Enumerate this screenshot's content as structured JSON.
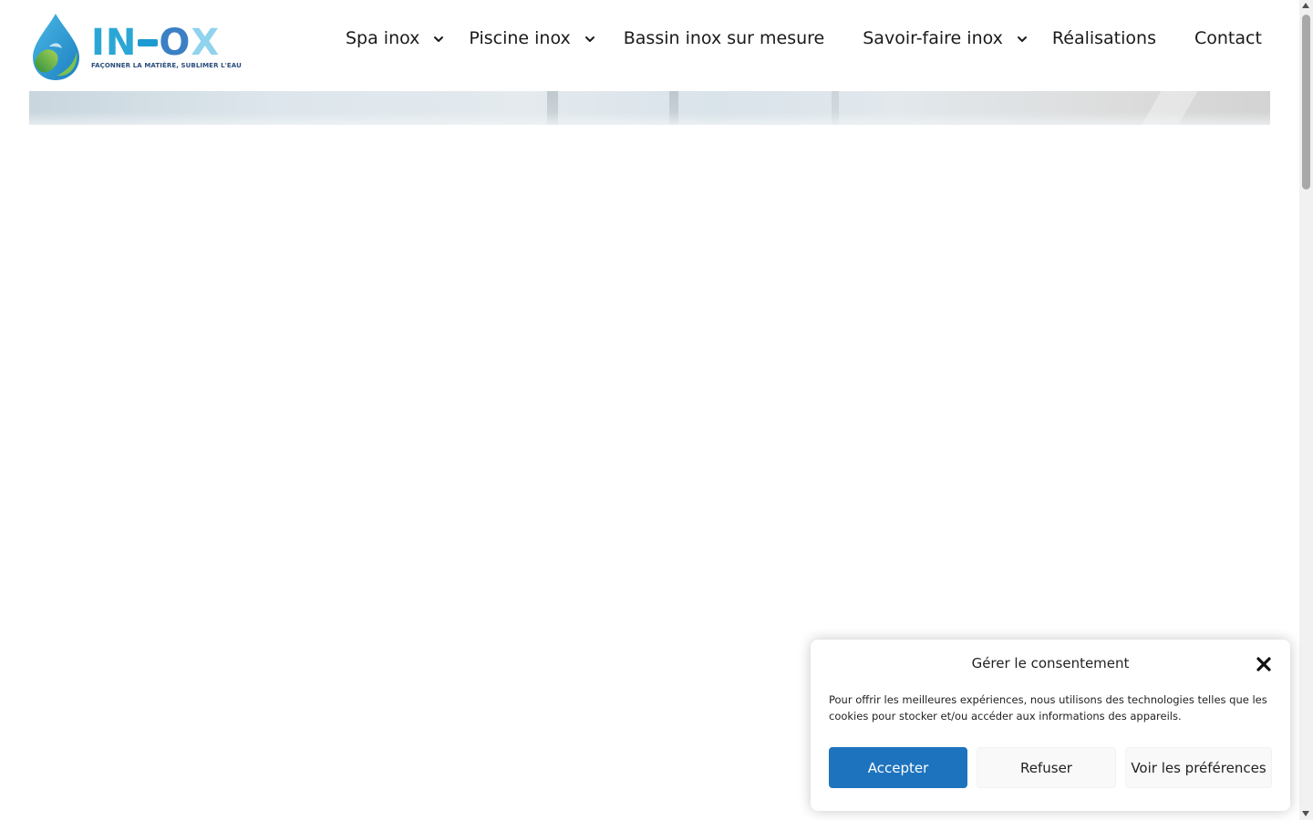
{
  "brand": {
    "logo_word_start": "IN",
    "logo_word_o": "O",
    "logo_word_x": "X",
    "tagline": "FAÇONNER LA MATIÈRE, SUBLIMER L'EAU"
  },
  "nav": {
    "items": [
      {
        "label": "Spa inox",
        "has_dropdown": true
      },
      {
        "label": "Piscine inox",
        "has_dropdown": true
      },
      {
        "label": "Bassin inox sur mesure",
        "has_dropdown": false
      },
      {
        "label": "Savoir-faire inox",
        "has_dropdown": true
      },
      {
        "label": "Réalisations",
        "has_dropdown": false
      },
      {
        "label": "Contact",
        "has_dropdown": false
      }
    ]
  },
  "consent": {
    "title": "Gérer le consentement",
    "body": "Pour offrir les meilleures expériences, nous utilisons des technologies telles que les cookies pour stocker et/ou accéder aux informations des appareils.",
    "accept_label": "Accepter",
    "refuse_label": "Refuser",
    "prefs_label": "Voir les préférences"
  },
  "colors": {
    "accent": "#1e73be",
    "logo_blue": "#2ba7d6",
    "logo_green": "#6cc04a",
    "text": "#1a1a1a"
  },
  "icons": {
    "dropdown": "chevron-down-icon",
    "close": "close-icon",
    "logo": "water-drop-logo-icon"
  }
}
